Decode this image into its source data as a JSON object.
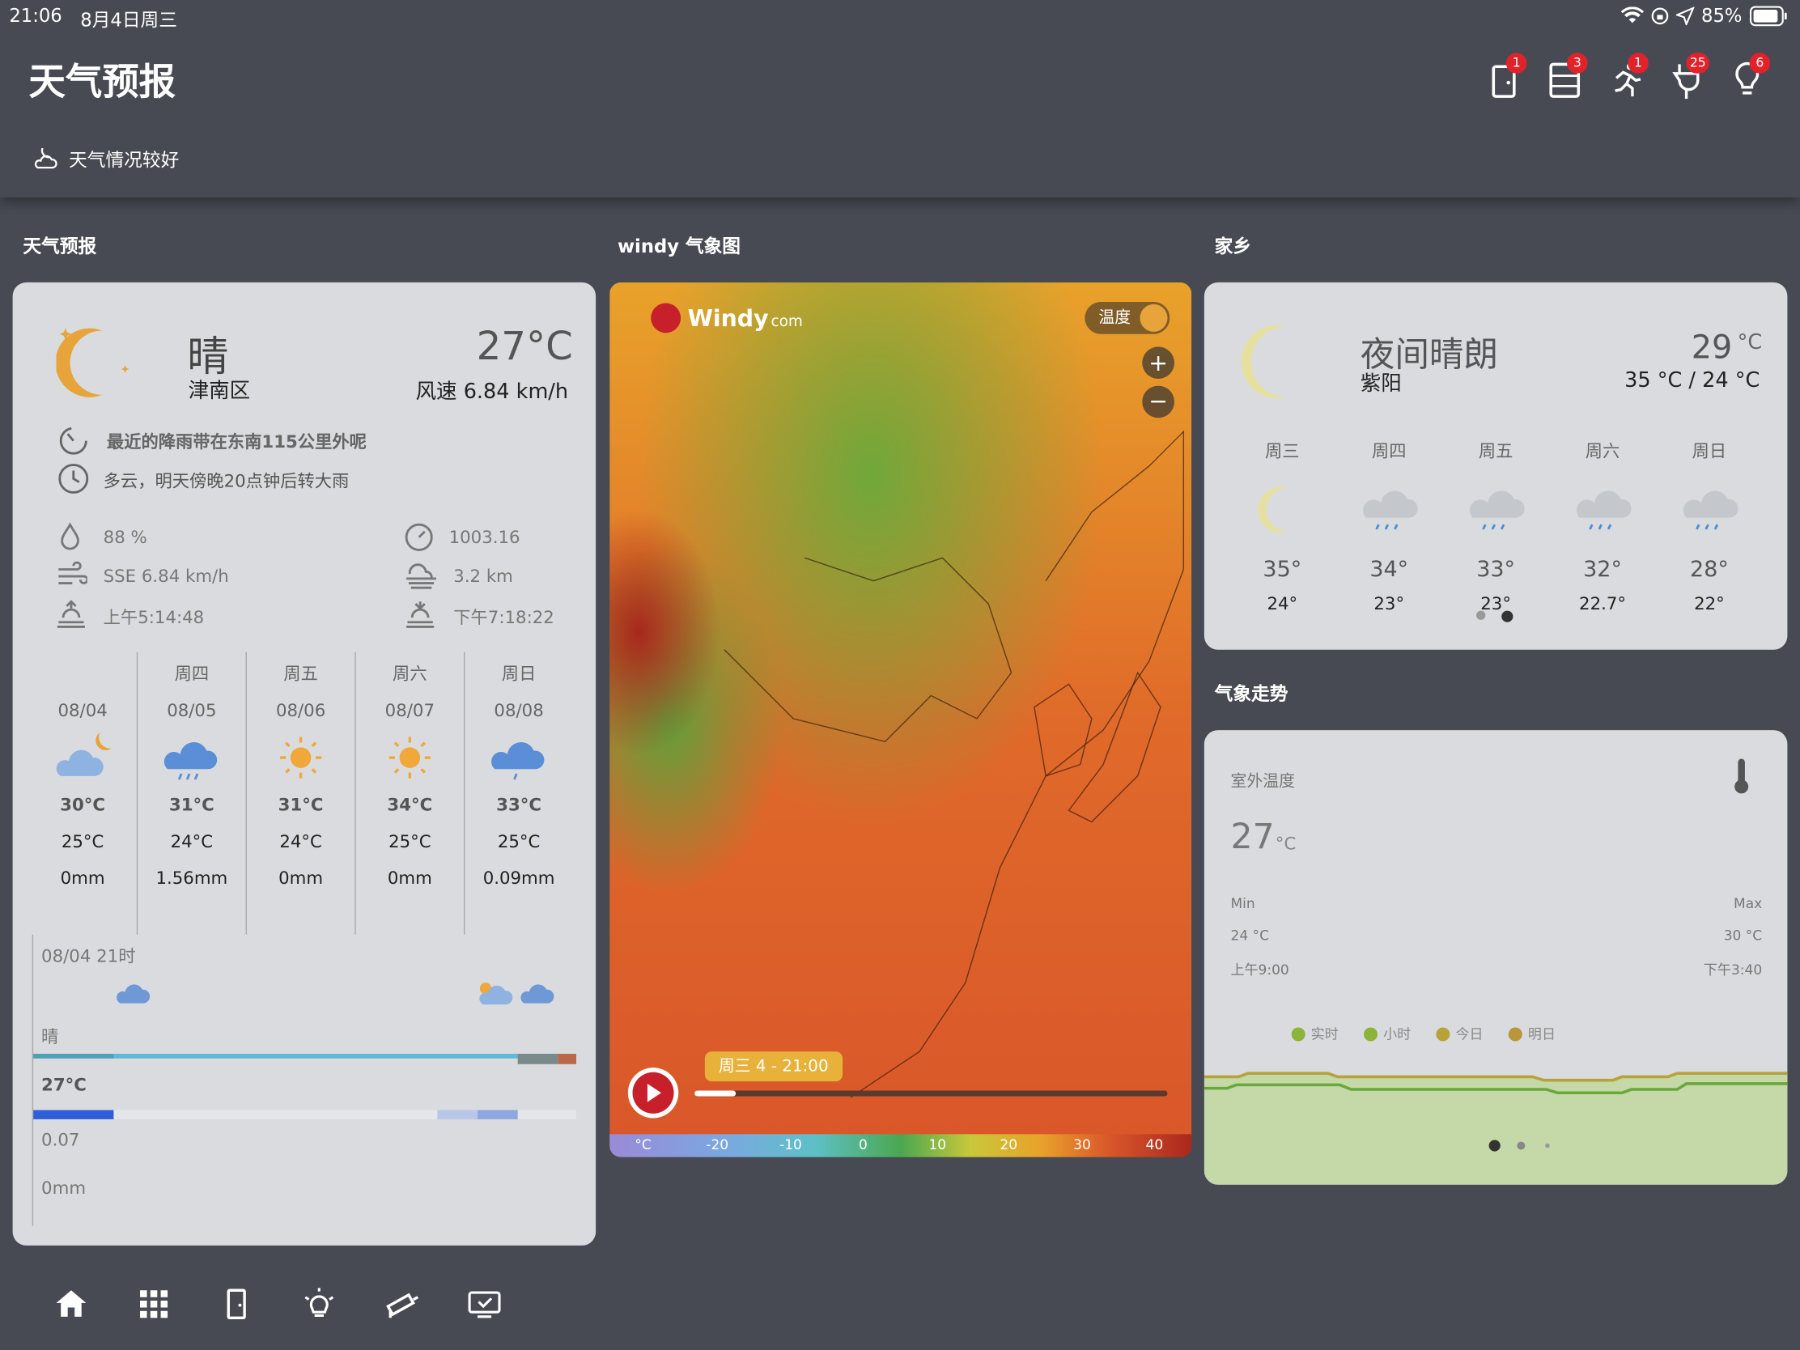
{
  "status": {
    "time": "21:06",
    "date": "8月4日周三",
    "battery": "85%"
  },
  "app": {
    "title": "天气预报",
    "banner": "天气情况较好",
    "badges": [
      "1",
      "3",
      "1",
      "25",
      "6"
    ]
  },
  "sections": {
    "forecast": "天气预报",
    "windy": "windy 气象图",
    "home": "家乡",
    "trend": "气象走势"
  },
  "current": {
    "condition": "晴",
    "location": "津南区",
    "temp": "27°C",
    "wind": "风速 6.84 km/h",
    "rain_alert": "最近的降雨带在东南115公里外呢",
    "outlook": "多云，明天傍晚20点钟后转大雨",
    "humidity": "88 %",
    "pressure": "1003.16",
    "wind_dir": "SSE 6.84 km/h",
    "visibility": "3.2 km",
    "sunrise": "上午5:14:48",
    "sunset": "下午7:18:22"
  },
  "daily": [
    {
      "day": "",
      "date": "08/04",
      "high": "30°C",
      "low": "25°C",
      "rain": "0mm",
      "icon": "partly-cloudy-night-icon"
    },
    {
      "day": "周四",
      "date": "08/05",
      "high": "31°C",
      "low": "24°C",
      "rain": "1.56mm",
      "icon": "rain-icon"
    },
    {
      "day": "周五",
      "date": "08/06",
      "high": "31°C",
      "low": "24°C",
      "rain": "0mm",
      "icon": "sun-icon"
    },
    {
      "day": "周六",
      "date": "08/07",
      "high": "34°C",
      "low": "25°C",
      "rain": "0mm",
      "icon": "sun-icon"
    },
    {
      "day": "周日",
      "date": "08/08",
      "high": "33°C",
      "low": "25°C",
      "rain": "0.09mm",
      "icon": "rain-icon"
    }
  ],
  "hourly": {
    "time": "08/04 21时",
    "condition": "晴",
    "temp": "27°C",
    "precip": "0.07",
    "rain": "0mm"
  },
  "windy": {
    "logo": "Windy",
    "logo_suffix": "com",
    "layer": "温度",
    "time": "周三 4 - 21:00",
    "unit": "°C",
    "scale": [
      "-20",
      "-10",
      "0",
      "10",
      "20",
      "30",
      "40"
    ]
  },
  "home": {
    "condition": "夜间晴朗",
    "location": "紫阳",
    "temp": "29",
    "unit": "°C",
    "range": "35 °C / 24 °C",
    "days": [
      {
        "day": "周三",
        "high": "35°",
        "low": "24°",
        "icon": "moon-icon"
      },
      {
        "day": "周四",
        "high": "34°",
        "low": "23°",
        "icon": "rain-cloud-icon"
      },
      {
        "day": "周五",
        "high": "33°",
        "low": "23°",
        "icon": "rain-cloud-icon"
      },
      {
        "day": "周六",
        "high": "32°",
        "low": "22.7°",
        "icon": "rain-cloud-icon"
      },
      {
        "day": "周日",
        "high": "28°",
        "low": "22°",
        "icon": "rain-cloud-icon"
      }
    ]
  },
  "trend": {
    "label": "室外温度",
    "value": "27",
    "unit": "°C",
    "min_label": "Min",
    "max_label": "Max",
    "min": "24 °C",
    "max": "30 °C",
    "min_time": "上午9:00",
    "max_time": "下午3:40",
    "legend": [
      "实时",
      "小时",
      "今日",
      "明日"
    ],
    "legend_colors": [
      "#8ab43a",
      "#8ab43a",
      "#b8a23a",
      "#b8963a"
    ]
  }
}
